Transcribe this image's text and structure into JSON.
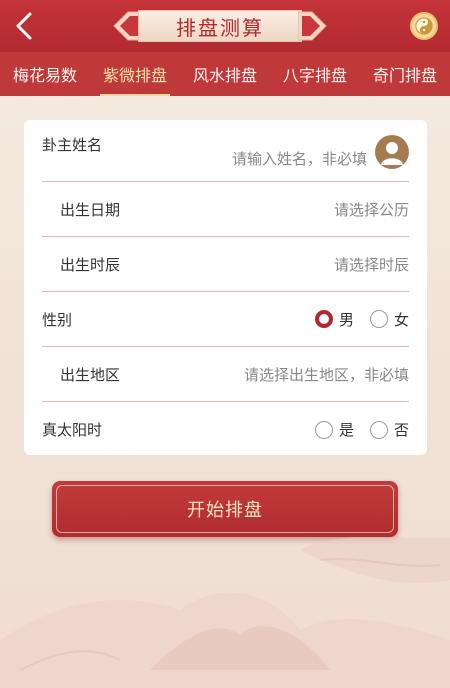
{
  "header": {
    "title": "排盘测算"
  },
  "tabs": [
    {
      "label": "梅花易数",
      "active": false
    },
    {
      "label": "紫微排盘",
      "active": true
    },
    {
      "label": "风水排盘",
      "active": false
    },
    {
      "label": "八字排盘",
      "active": false
    },
    {
      "label": "奇门排盘",
      "active": false
    }
  ],
  "form": {
    "name": {
      "label": "卦主姓名",
      "placeholder": "请输入姓名，非必填"
    },
    "birth_date": {
      "label": "出生日期",
      "placeholder": "请选择公历"
    },
    "birth_hour": {
      "label": "出生时辰",
      "placeholder": "请选择时辰"
    },
    "gender": {
      "label": "性别",
      "options": [
        "男",
        "女"
      ],
      "selected": "男"
    },
    "birth_place": {
      "label": "出生地区",
      "placeholder": "请选择出生地区，非必填"
    },
    "solar_time": {
      "label": "真太阳时",
      "options": [
        "是",
        "否"
      ],
      "selected": ""
    }
  },
  "start_button": {
    "label": "开始排盘"
  },
  "colors": {
    "primary_red": "#c0393a",
    "accent_gold": "#f6e2a8",
    "divider_pink": "#efb3b3"
  },
  "icons": {
    "back": "chevron-left-icon",
    "yinyang": "yinyang-icon",
    "avatar": "user-avatar-icon"
  }
}
